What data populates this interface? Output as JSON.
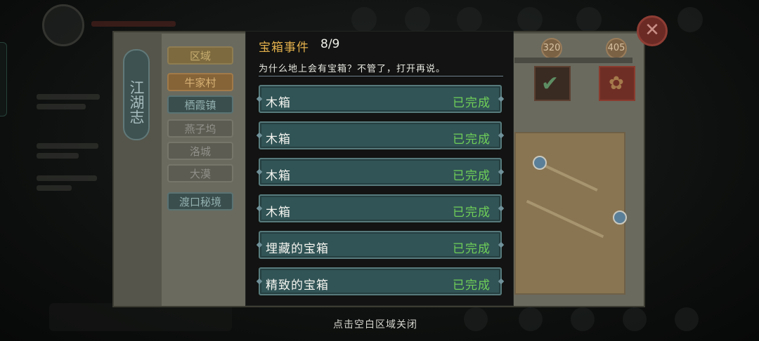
{
  "modal": {
    "title": "宝箱事件",
    "count": "8/9",
    "description": "为什么地上会有宝箱？不管了，打开再说。",
    "events": [
      {
        "name": "木箱",
        "status": "已完成"
      },
      {
        "name": "木箱",
        "status": "已完成"
      },
      {
        "name": "木箱",
        "status": "已完成"
      },
      {
        "name": "木箱",
        "status": "已完成"
      },
      {
        "name": "埋藏的宝箱",
        "status": "已完成"
      },
      {
        "name": "精致的宝箱",
        "status": "已完成"
      }
    ]
  },
  "book": {
    "spine_title": "江湖志",
    "region_header": "区域",
    "regions": [
      "牛家村",
      "栖霞镇",
      "燕子坞",
      "洛城",
      "大漠",
      "渡口秘境"
    ],
    "badges": [
      "320",
      "405"
    ]
  },
  "footer": {
    "hint": "点击空白区域关闭"
  },
  "colors": {
    "title_gold": "#e3b04c",
    "completed_green": "#6fcf58",
    "row_teal": "#315456"
  },
  "icons": {
    "close": "close-icon",
    "check": "check-icon",
    "flower": "flower-icon"
  }
}
